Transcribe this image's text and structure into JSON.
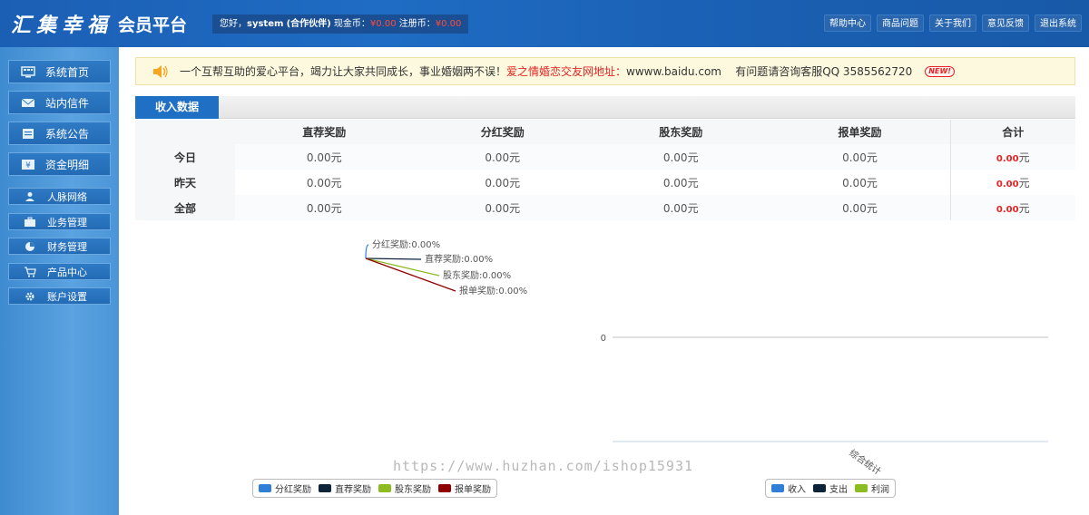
{
  "header": {
    "logo_script": "汇集幸福",
    "logo_main": "会员平台",
    "greeting": "您好，",
    "username": "system",
    "role": "(合作伙伴)",
    "cash_label": " 现金币：",
    "cash_value": "¥0.00",
    "reg_label": " 注册币：",
    "reg_value": "¥0.00",
    "nav": [
      "帮助中心",
      "商品问题",
      "关于我们",
      "意见反馈",
      "退出系统"
    ]
  },
  "sidebar": {
    "items": [
      {
        "label": "系统首页",
        "icon": "monitor-icon"
      },
      {
        "label": "站内信件",
        "icon": "mail-icon"
      },
      {
        "label": "系统公告",
        "icon": "notice-icon"
      },
      {
        "label": "资金明细",
        "icon": "money-icon"
      },
      {
        "label": "人脉网络",
        "icon": "people-icon"
      },
      {
        "label": "业务管理",
        "icon": "briefcase-icon"
      },
      {
        "label": "财务管理",
        "icon": "pie-icon"
      },
      {
        "label": "产品中心",
        "icon": "cart-icon"
      },
      {
        "label": "账户设置",
        "icon": "gear-icon"
      }
    ]
  },
  "notice": {
    "text1": "一个互帮互助的爱心平台，竭力让大家共同成长，事业婚姻两不误！",
    "text_red": "爱之情婚恋交友网地址：",
    "text2": "wwww.baidu.com    有问题请咨询客服QQ 3585562720",
    "badge": "NEW!"
  },
  "tab": {
    "label": "收入数据"
  },
  "table": {
    "headers": [
      "",
      "直荐奖励",
      "分红奖励",
      "股东奖励",
      "报单奖励",
      "合计"
    ],
    "rows": [
      {
        "label": "今日",
        "values": [
          "0.00元",
          "0.00元",
          "0.00元",
          "0.00元"
        ],
        "total": "0.00",
        "unit": "元"
      },
      {
        "label": "昨天",
        "values": [
          "0.00元",
          "0.00元",
          "0.00元",
          "0.00元"
        ],
        "total": "0.00",
        "unit": "元"
      },
      {
        "label": "全部",
        "values": [
          "0.00元",
          "0.00元",
          "0.00元",
          "0.00元"
        ],
        "total": "0.00",
        "unit": "元"
      }
    ]
  },
  "chart_data": [
    {
      "type": "pie",
      "labels": [
        "分红奖励:0.00%",
        "直荐奖励:0.00%",
        "股东奖励:0.00%",
        "报单奖励:0.00%"
      ],
      "categories": [
        "分红奖励",
        "直荐奖励",
        "股东奖励",
        "报单奖励"
      ],
      "values": [
        0,
        0,
        0,
        0
      ],
      "colors": [
        "#2f7ed8",
        "#0d233a",
        "#8bbc21",
        "#910000"
      ],
      "legend": [
        "分红奖励",
        "直荐奖励",
        "股东奖励",
        "报单奖励"
      ]
    },
    {
      "type": "bar",
      "categories": [
        "综合统计"
      ],
      "series": [
        {
          "name": "收入",
          "values": [
            0
          ]
        },
        {
          "name": "支出",
          "values": [
            0
          ]
        },
        {
          "name": "利润",
          "values": [
            0
          ]
        }
      ],
      "colors": [
        "#2f7ed8",
        "#0d233a",
        "#8bbc21"
      ],
      "y_tick": "0",
      "legend": [
        "收入",
        "支出",
        "利润"
      ]
    }
  ],
  "watermark": "https://www.huzhan.com/ishop15931"
}
